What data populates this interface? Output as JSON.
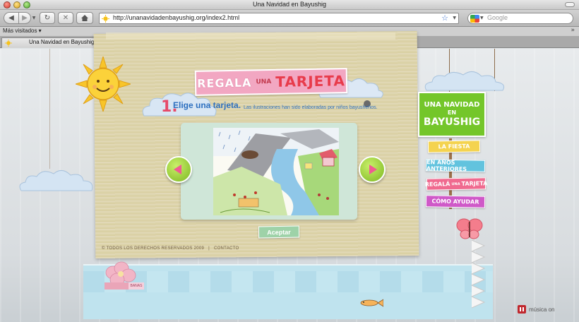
{
  "window": {
    "title": "Una Navidad en Bayushig"
  },
  "navbar": {
    "url": "http://unanavidadenbayushig.org/index2.html",
    "search_placeholder": "Google"
  },
  "bookmarks": {
    "most_visited": "Más visitados ▾"
  },
  "tabs": [
    {
      "label": "Una Navidad en Bayushig"
    }
  ],
  "page": {
    "title": {
      "regala": "REGALA",
      "una": "UNA",
      "tarjeta": "TARJETA"
    },
    "step": {
      "number": "1.",
      "title": "Elige una tarjeta.",
      "description": "Las ilustraciones han sido elaboradas por niños bayusheños."
    },
    "accept_label": "Aceptar",
    "footer": {
      "rights": "© TODOS LOS DERECHOS RESERVADOS 2009",
      "separator": "|",
      "contact": "CONTACTO"
    },
    "logo": {
      "line1": "UNA NAVIDAD",
      "line2": "EN",
      "line3": "BAYUSHIG"
    },
    "menu": {
      "fiesta": "LA FIESTA",
      "anteriores": "EN AÑOS ANTERIORES",
      "regala_a": "REGALÁ",
      "regala_b": "UNA",
      "regala_c": "TARJETA",
      "ayudar": "CÓMO AYUDAR"
    },
    "gift_tag": "BANAS",
    "music_label": "música on"
  },
  "colors": {
    "title_banner": "#f2a7c2",
    "title_red": "#e83b4b",
    "step_blue": "#2c6fbf",
    "logo_green": "#74c62a",
    "menu_yellow": "#f4d34f",
    "menu_cyan": "#62c3de",
    "menu_pink": "#f06a8f",
    "menu_purple": "#cf59c8",
    "arrow_green": "#7db821"
  },
  "icons": [
    "back-icon",
    "forward-icon",
    "reload-icon",
    "stop-icon",
    "home-icon",
    "bookmark-star-icon",
    "google-icon",
    "sun-icon",
    "prev-arrow-icon",
    "next-arrow-icon",
    "butterfly-icon",
    "fish-icon",
    "pause-icon"
  ]
}
